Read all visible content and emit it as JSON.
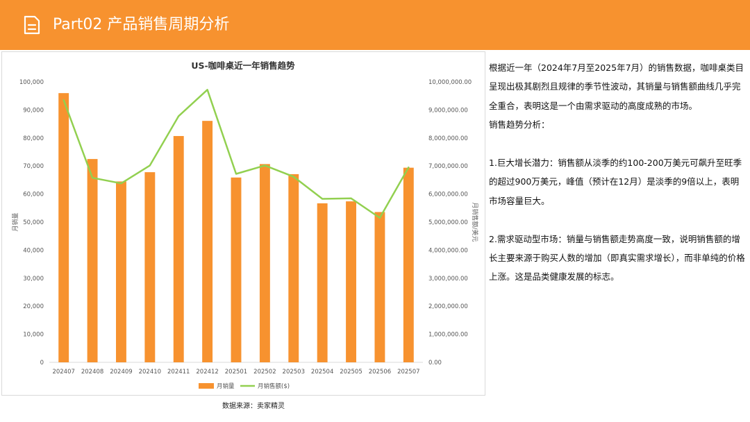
{
  "header": {
    "title": "Part02 产品销售周期分析",
    "background": "#F7922F",
    "icon": "document-icon"
  },
  "chart_data": {
    "type": "bar+line",
    "title": "US-咖啡桌近一年销售趋势",
    "categories": [
      "202407",
      "202408",
      "202409",
      "202410",
      "202411",
      "202412",
      "202501",
      "202502",
      "202503",
      "202504",
      "202505",
      "202506",
      "202507"
    ],
    "series": [
      {
        "name": "月销量",
        "type": "bar",
        "axis": "left",
        "color": "#F7922F",
        "values": [
          96000,
          72500,
          64500,
          67800,
          80700,
          86100,
          65900,
          70700,
          67100,
          56700,
          57400,
          53600,
          69400
        ]
      },
      {
        "name": "月销售额($)",
        "type": "line",
        "axis": "right",
        "color": "#92D050",
        "values": [
          9350000,
          6580000,
          6380000,
          7020000,
          8780000,
          9720000,
          6720000,
          7020000,
          6620000,
          5830000,
          5850000,
          5150000,
          6950000
        ]
      }
    ],
    "ylabel": "月销量",
    "y2label": "月销售额/美元",
    "ylim": [
      0,
      100000
    ],
    "y2lim": [
      0,
      10000000
    ],
    "yticks": [
      "0",
      "10,000",
      "20,000",
      "30,000",
      "40,000",
      "50,000",
      "60,000",
      "70,000",
      "80,000",
      "90,000",
      "100,000"
    ],
    "y2ticks": [
      "0.00",
      "1,000,000.00",
      "2,000,000.00",
      "3,000,000.00",
      "4,000,000.00",
      "5,000,000.00",
      "6,000,000.00",
      "7,000,000.00",
      "8,000,000.00",
      "9,000,000.00",
      "10,000,000.00"
    ],
    "legend_position": "bottom",
    "grid": false
  },
  "source": "数据来源：卖家精灵",
  "text": {
    "intro": "根据近一年（2024年7月至2025年7月）的销售数据，咖啡桌类目呈现出极其剧烈且规律的季节性波动，其销量与销售额曲线几乎完全重合，表明这是一个由需求驱动的高度成熟的市场。",
    "heading": "销售趋势分析：",
    "point1": "1.巨大增长潜力：销售额从淡季的约100-200万美元可飙升至旺季的超过900万美元，峰值（预计在12月）是淡季的9倍以上，表明市场容量巨大。",
    "point2": "2.需求驱动型市场：销量与销售额走势高度一致，说明销售额的增长主要来源于购买人数的增加（即真实需求增长），而非单纯的价格上涨。这是品类健康发展的标志。"
  }
}
